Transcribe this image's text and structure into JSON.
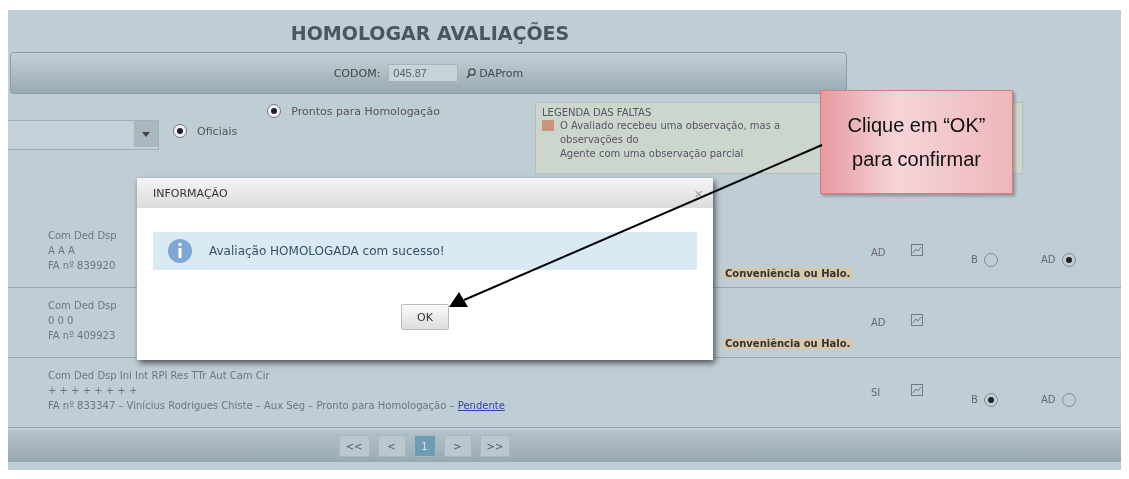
{
  "page": {
    "title": "HOMOLOGAR AVALIAÇÕES"
  },
  "toolbar": {
    "codom_label": "CODOM:",
    "codom_value": "045.87",
    "search_link": "DAProm"
  },
  "filters": {
    "options": [
      {
        "label": "Oficiais",
        "checked": true
      },
      {
        "label": "Prontos para Homologação",
        "checked": true
      }
    ]
  },
  "legend": {
    "title": "LEGENDA DAS FALTAS",
    "items": [
      {
        "text": "O Avaliado recebeu uma observação, mas a",
        "color": "#c8957a"
      },
      {
        "text": "observações do"
      },
      {
        "text": "Agente com uma observação parcial"
      }
    ]
  },
  "rows": [
    {
      "headers": "Com Ded Dsp",
      "marks": "A A A",
      "info": "FA nº 839920",
      "note": "Conveniência ou Halo.",
      "grade": "AD",
      "options": [
        {
          "label": "B",
          "selected": false
        },
        {
          "label": "AD",
          "selected": true
        }
      ]
    },
    {
      "headers": "Com Ded Dsp",
      "marks": "0 0 0",
      "info": "FA nº 409923",
      "note": "Conveniência ou Halo.",
      "grade": "AD",
      "options": []
    },
    {
      "headers": "Com Ded Dsp Ini Int RPI Res TTr Aut Cam Cir",
      "marks": "+ + + + + + + +",
      "info": "FA nº 833347 – Vinícius Rodrigues Chiste – Aux Seg – Pronto para Homologação –",
      "link": "Pendente",
      "grade": "SI",
      "options": [
        {
          "label": "B",
          "selected": true
        },
        {
          "label": "AD",
          "selected": false
        }
      ]
    }
  ],
  "pager": [
    {
      "label": "<<",
      "selected": false
    },
    {
      "label": "<",
      "selected": false
    },
    {
      "label": "1",
      "selected": true
    },
    {
      "label": ">",
      "selected": false
    },
    {
      "label": ">>",
      "selected": false
    }
  ],
  "modal": {
    "title": "INFORMAÇÃO",
    "close": "×",
    "message": "Avaliação HOMOLOGADA com sucesso!",
    "button": "OK"
  },
  "callout": {
    "text": "Clique em “OK” para confirmar"
  }
}
